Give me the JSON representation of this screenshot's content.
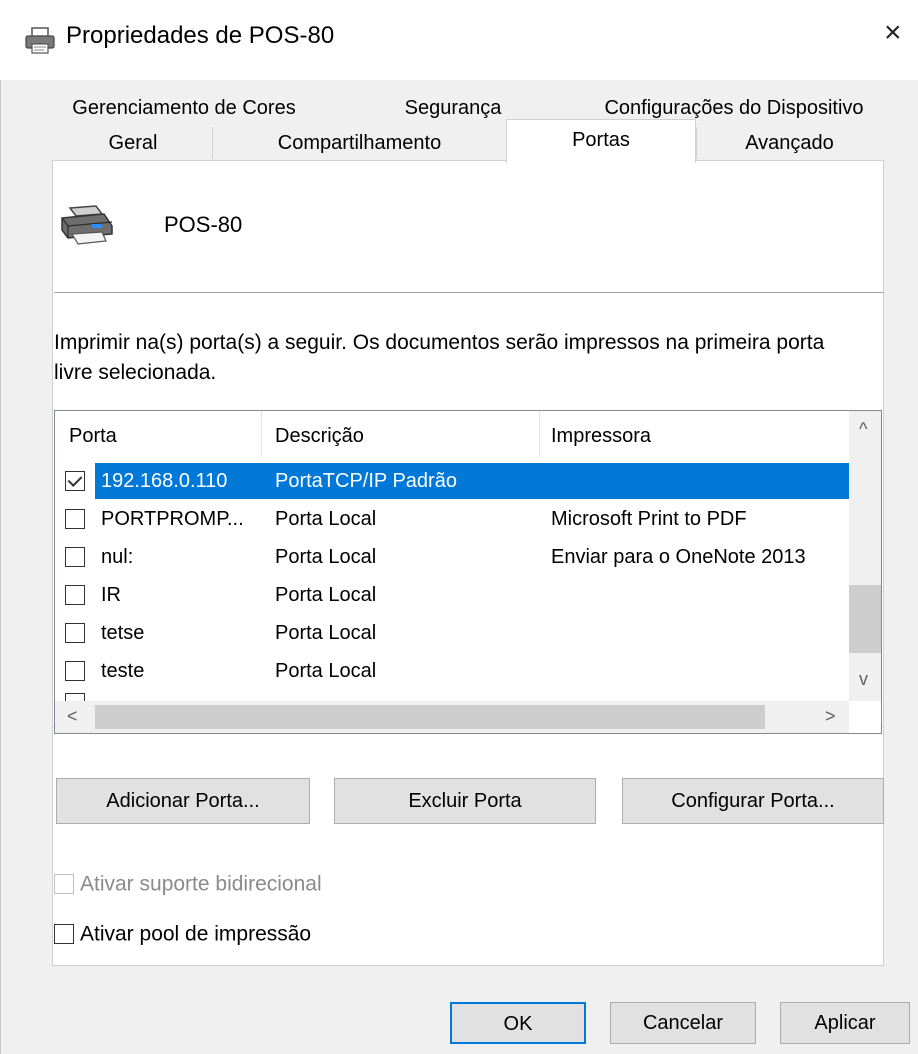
{
  "window": {
    "title": "Propriedades de POS-80",
    "close_glyph": "×",
    "icon": "printer-icon"
  },
  "tabs": {
    "row1": [
      "Gerenciamento de Cores",
      "Segurança",
      "Configurações do Dispositivo"
    ],
    "row2": [
      "Geral",
      "Compartilhamento",
      "Portas",
      "Avançado"
    ],
    "active": "Portas"
  },
  "printer": {
    "name": "POS-80",
    "icon": "printer-icon"
  },
  "intro_text": "Imprimir na(s) porta(s) a seguir. Os documentos serão impressos na primeira porta livre selecionada.",
  "ports_list": {
    "columns": [
      "Porta",
      "Descrição",
      "Impressora"
    ],
    "rows": [
      {
        "checked": true,
        "port": "192.168.0.110",
        "description": "PortaTCP/IP Padrão",
        "printer": "",
        "selected": true
      },
      {
        "checked": false,
        "port": "PORTPROMP...",
        "description": "Porta Local",
        "printer": "Microsoft Print to PDF",
        "selected": false
      },
      {
        "checked": false,
        "port": "nul:",
        "description": "Porta Local",
        "printer": "Enviar para o OneNote 2013",
        "selected": false
      },
      {
        "checked": false,
        "port": "IR",
        "description": "Porta Local",
        "printer": "",
        "selected": false
      },
      {
        "checked": false,
        "port": "tetse",
        "description": "Porta Local",
        "printer": "",
        "selected": false
      },
      {
        "checked": false,
        "port": "teste",
        "description": "Porta Local",
        "printer": "",
        "selected": false
      }
    ],
    "scroll_up": "^",
    "scroll_down": "v",
    "scroll_left": "<",
    "scroll_right": ">"
  },
  "port_buttons": {
    "add": "Adicionar Porta...",
    "delete": "Excluir Porta",
    "configure": "Configurar Porta..."
  },
  "options": {
    "bidirectional": {
      "label": "Ativar suporte bidirecional",
      "checked": false,
      "enabled": false
    },
    "pool": {
      "label": "Ativar pool de impressão",
      "checked": false,
      "enabled": true
    }
  },
  "dialog_buttons": {
    "ok": "OK",
    "cancel": "Cancelar",
    "apply": "Aplicar"
  },
  "colors": {
    "selection": "#0078d7",
    "window_bg": "#f0f0f0",
    "panel_bg": "#ffffff"
  }
}
